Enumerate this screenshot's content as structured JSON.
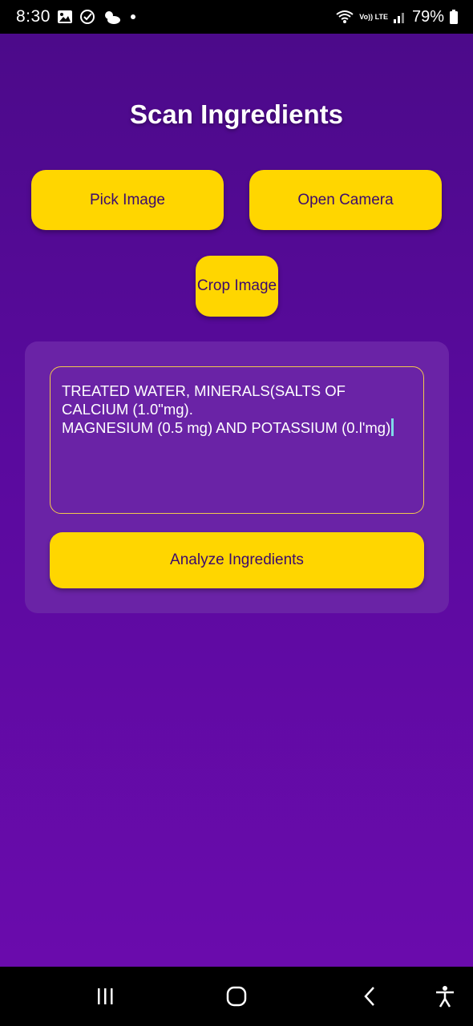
{
  "status_bar": {
    "time": "8:30",
    "network": "Vo)) LTE",
    "battery": "79%",
    "icons": [
      "gallery-icon",
      "check-circle-icon",
      "weather-icon",
      "notification-dot",
      "wifi-icon",
      "signal-icon",
      "battery-icon"
    ]
  },
  "screen": {
    "title": "Scan Ingredients"
  },
  "buttons": {
    "pick_image": "Pick Image",
    "open_camera": "Open Camera",
    "crop_image": "Crop Image",
    "analyze": "Analyze Ingredients"
  },
  "ingredients_text": {
    "line1": "TREATED WATER, MINERALS(SALTS OF",
    "line2": "CALCIUM (1.0\"mg).",
    "line3": "MAGNESIUM (0.5 mg) AND POTASSIUM (0.l'mg)"
  },
  "nav_bar": {
    "icons": [
      "recent-apps-icon",
      "home-icon",
      "back-icon",
      "accessibility-icon"
    ]
  },
  "colors": {
    "background_top": "#4c0a8a",
    "background_bottom": "#6a0bac",
    "accent": "#ffd600",
    "button_text": "#3b0a6e",
    "card": "#6a23a6"
  }
}
